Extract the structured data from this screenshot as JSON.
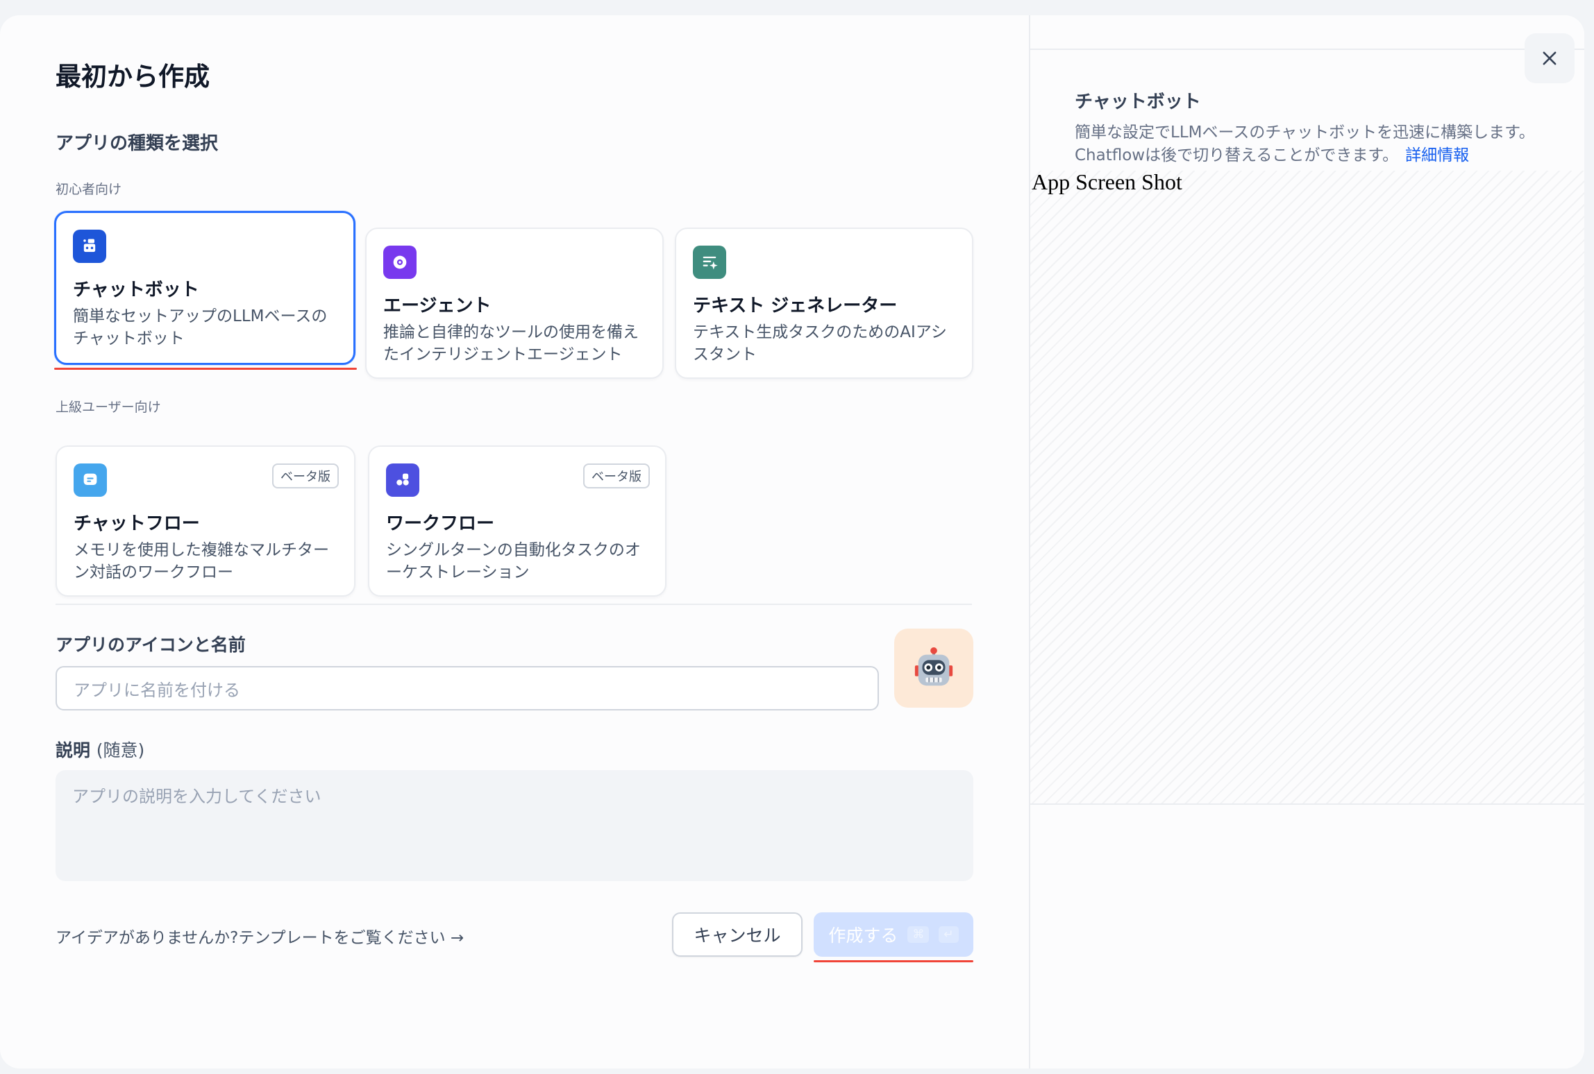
{
  "dialog": {
    "title": "最初から作成",
    "section_title": "アプリの種類を選択",
    "beginner_label": "初心者向け",
    "advanced_label": "上級ユーザー向け"
  },
  "app_types": {
    "chatbot": {
      "name": "チャットボット",
      "desc": "簡単なセットアップのLLMベースのチャットボット",
      "icon": "robot-icon",
      "color": "#1e56d9",
      "selected": true
    },
    "agent": {
      "name": "エージェント",
      "desc": "推論と自律的なツールの使用を備えたインテリジェントエージェント",
      "icon": "agent-icon",
      "color": "#7839ee"
    },
    "textgen": {
      "name": "テキスト ジェネレーター",
      "desc": "テキスト生成タスクのためのAIアシスタント",
      "icon": "text-sparkle-icon",
      "color": "#3f8d7f"
    },
    "chatflow": {
      "name": "チャットフロー",
      "desc": "メモリを使用した複雑なマルチターン対話のワークフロー",
      "icon": "chat-bubble-icon",
      "color": "#45a6ed",
      "badge": "ベータ版"
    },
    "workflow": {
      "name": "ワークフロー",
      "desc": "シングルターンの自動化タスクのオーケストレーション",
      "icon": "workflow-icon",
      "color": "#4d50e0",
      "badge": "ベータ版"
    }
  },
  "form": {
    "name_label": "アプリのアイコンと名前",
    "name_placeholder": "アプリに名前を付ける",
    "app_icon": "robot-emoji-icon",
    "desc_label": "説明",
    "desc_optional": "(随意)",
    "desc_placeholder": "アプリの説明を入力してください"
  },
  "footer": {
    "template_link": "アイデアがありませんか?テンプレートをご覧ください →",
    "cancel": "キャンセル",
    "create": "作成する",
    "shortcut_cmd": "⌘",
    "shortcut_enter": "↵"
  },
  "preview": {
    "title": "チャットボット",
    "desc_line1": "簡単な設定でLLMベースのチャットボットを迅速に構築します。",
    "desc_line2": "Chatflowは後で切り替えることができます。",
    "learn_more": "詳細情報",
    "screenshot_label": "App Screen Shot"
  },
  "colors": {
    "accent": "#2970ff",
    "annotation": "#f04438"
  }
}
